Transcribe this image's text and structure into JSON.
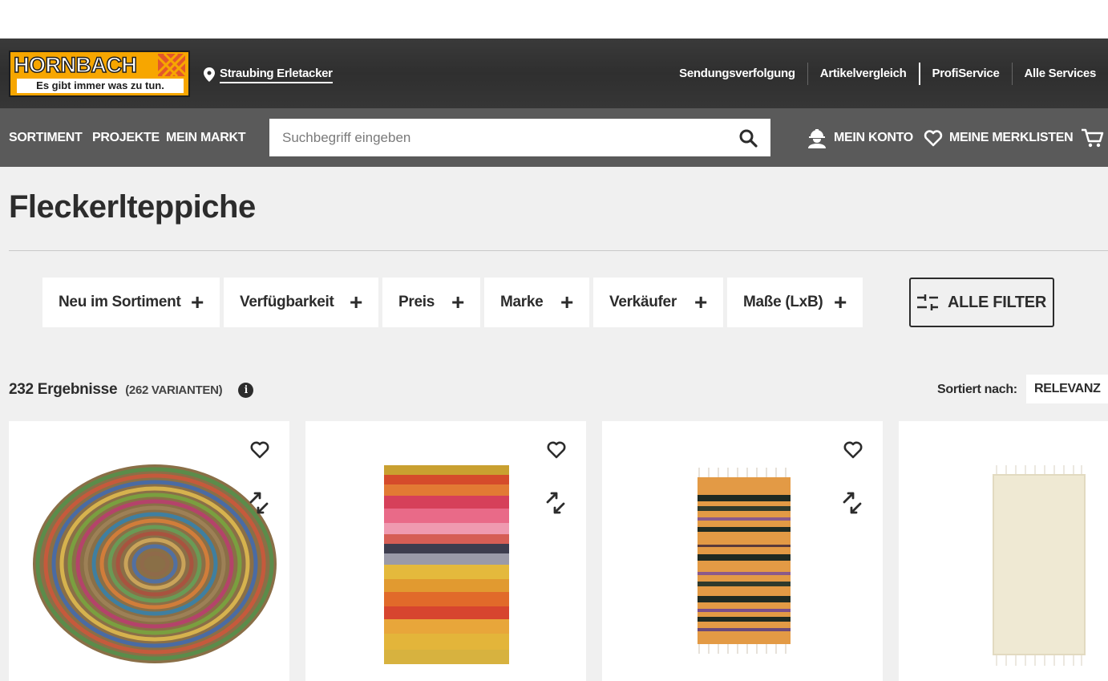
{
  "brand": {
    "logo_text": "HORNBACH",
    "slogan": "Es gibt immer was zu tun.",
    "color": "#f7a600"
  },
  "store": {
    "icon": "location-pin-icon",
    "name": "Straubing Erletacker"
  },
  "top_links": [
    "Sendungsverfolgung",
    "Artikelvergleich",
    "ProfiService",
    "Alle Services"
  ],
  "nav": {
    "items": [
      "SORTIMENT",
      "PROJEKTE",
      "MEIN MARKT"
    ],
    "search_placeholder": "Suchbegriff eingeben",
    "account_label": "MEIN KONTO",
    "wishlist_label": "MEINE MERKLISTEN"
  },
  "page": {
    "title": "Fleckerlteppiche"
  },
  "filters": {
    "chips": [
      "Neu im Sortiment",
      "Verfügbarkeit",
      "Preis",
      "Marke",
      "Verkäufer",
      "Maße (LxB)"
    ],
    "plus_symbol": "+",
    "all_filters_label": "ALLE FILTER"
  },
  "results": {
    "count": "232 Ergebnisse",
    "variants": "(262 VARIANTEN)",
    "info_symbol": "i",
    "sort_label": "Sortiert nach:",
    "sort_value": "RELEVANZ"
  },
  "products": [
    {
      "image": "round-braided-jute-rug",
      "favorite_icon": "heart-icon",
      "compare_icon": "compare-arrows-icon"
    },
    {
      "image": "colorful-striped-runner-rug",
      "favorite_icon": "heart-icon",
      "compare_icon": "compare-arrows-icon"
    },
    {
      "image": "orange-black-striped-kilim-rug",
      "favorite_icon": "heart-icon",
      "compare_icon": "compare-arrows-icon"
    },
    {
      "image": "cream-shaggy-rug",
      "favorite_icon": "heart-icon",
      "compare_icon": "compare-arrows-icon"
    }
  ]
}
